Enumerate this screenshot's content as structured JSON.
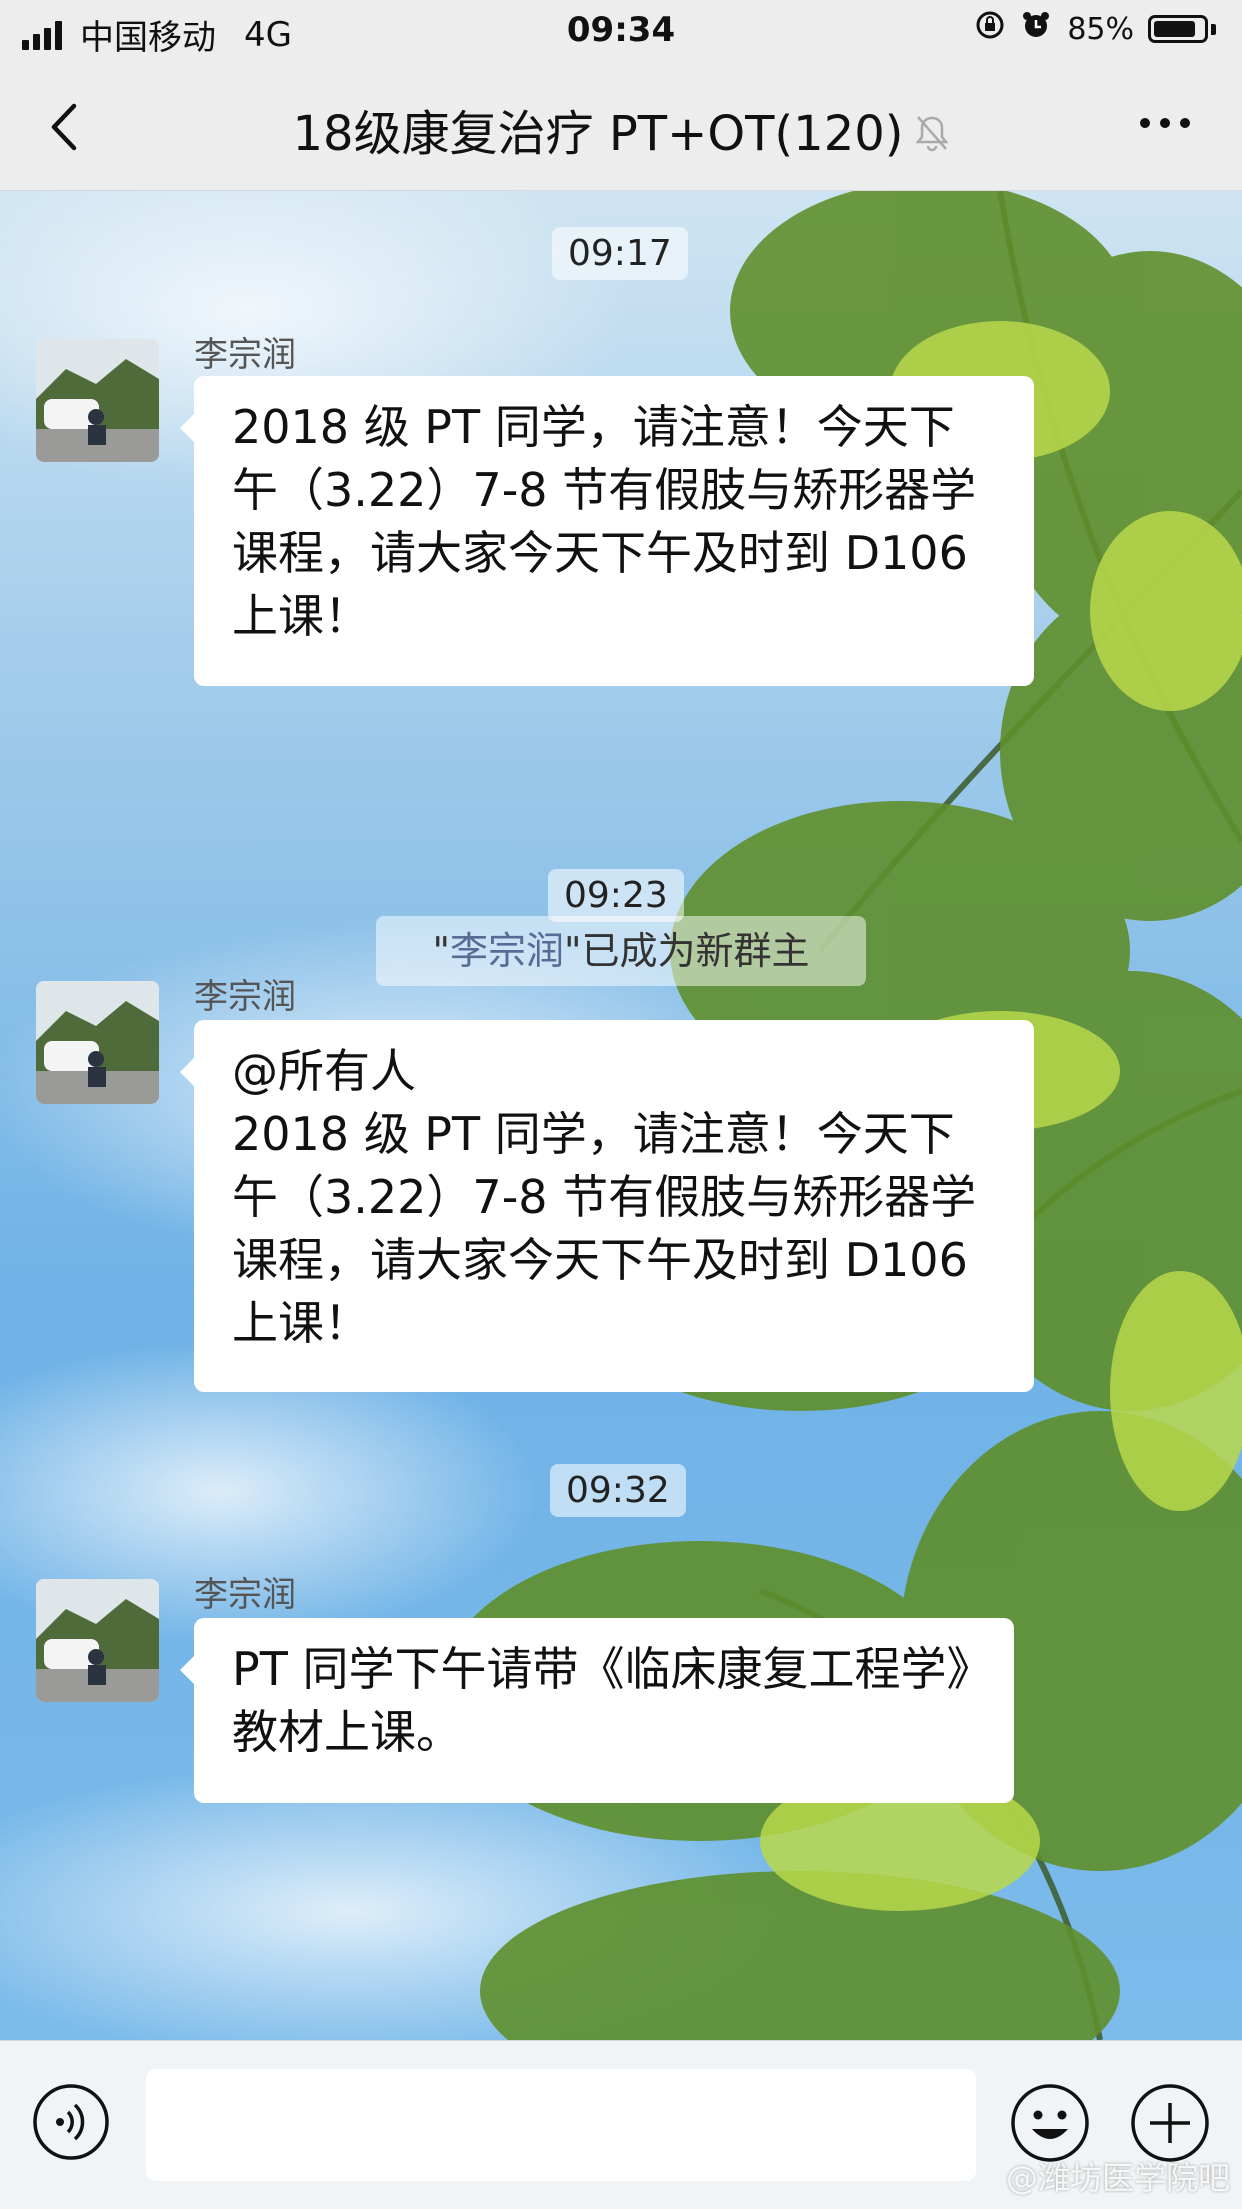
{
  "status_bar": {
    "carrier": "中国移动",
    "network": "4G",
    "time": "09:34",
    "battery": "85%",
    "battery_level": 0.85
  },
  "nav": {
    "title": "18级康复治疗 PT+OT(120)",
    "icons": [
      "back-icon",
      "mute-bell-icon",
      "more-icon"
    ]
  },
  "chat": {
    "time_1": "09:17",
    "time_2": "09:23",
    "time_3": "09:32",
    "system_notice": {
      "quote_open": "\"",
      "name": "李宗润",
      "text": "\"已成为新群主"
    },
    "messages": [
      {
        "sender": "李宗润",
        "text": "2018 级 PT 同学，请注意！今天下午（3.22）7-8 节有假肢与矫形器学课程，请大家今天下午及时到 D106 上课！"
      },
      {
        "sender": "李宗润",
        "text": "@所有人\n2018 级 PT 同学，请注意！今天下午（3.22）7-8 节有假肢与矫形器学课程，请大家今天下午及时到 D106 上课！"
      },
      {
        "sender": "李宗润",
        "text": "PT 同学下午请带《临床康复工程学》教材上课。"
      }
    ]
  },
  "input_bar": {
    "placeholder": "",
    "icons": [
      "voice-icon",
      "emoji-icon",
      "plus-icon"
    ]
  },
  "watermark": "@潍坊医学院吧",
  "colors": {
    "bubble": "#ffffff",
    "link": "#576b95",
    "bar_background": "#ededed"
  }
}
